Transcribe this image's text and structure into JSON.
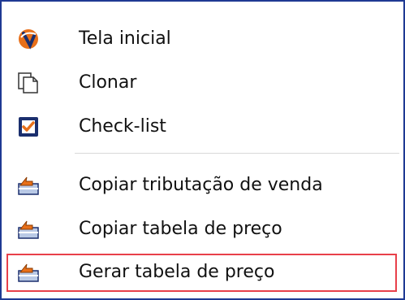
{
  "menu": {
    "items": [
      {
        "label": "Tela inicial",
        "icon": "home-logo-icon"
      },
      {
        "label": "Clonar",
        "icon": "clone-pages-icon"
      },
      {
        "label": "Check-list",
        "icon": "checkbox-icon"
      },
      {
        "label": "Copiar tributação de venda",
        "icon": "folder-arrow-icon"
      },
      {
        "label": "Copiar tabela de preço",
        "icon": "folder-arrow-icon"
      },
      {
        "label": "Gerar tabela de preço",
        "icon": "folder-arrow-icon"
      }
    ],
    "highlighted_item": "Gerar tabela de preço"
  },
  "colors": {
    "border": "#1f3a93",
    "highlight": "#e8404a",
    "accent_orange": "#e8701a",
    "checkbox_blue": "#1b2f6e"
  }
}
